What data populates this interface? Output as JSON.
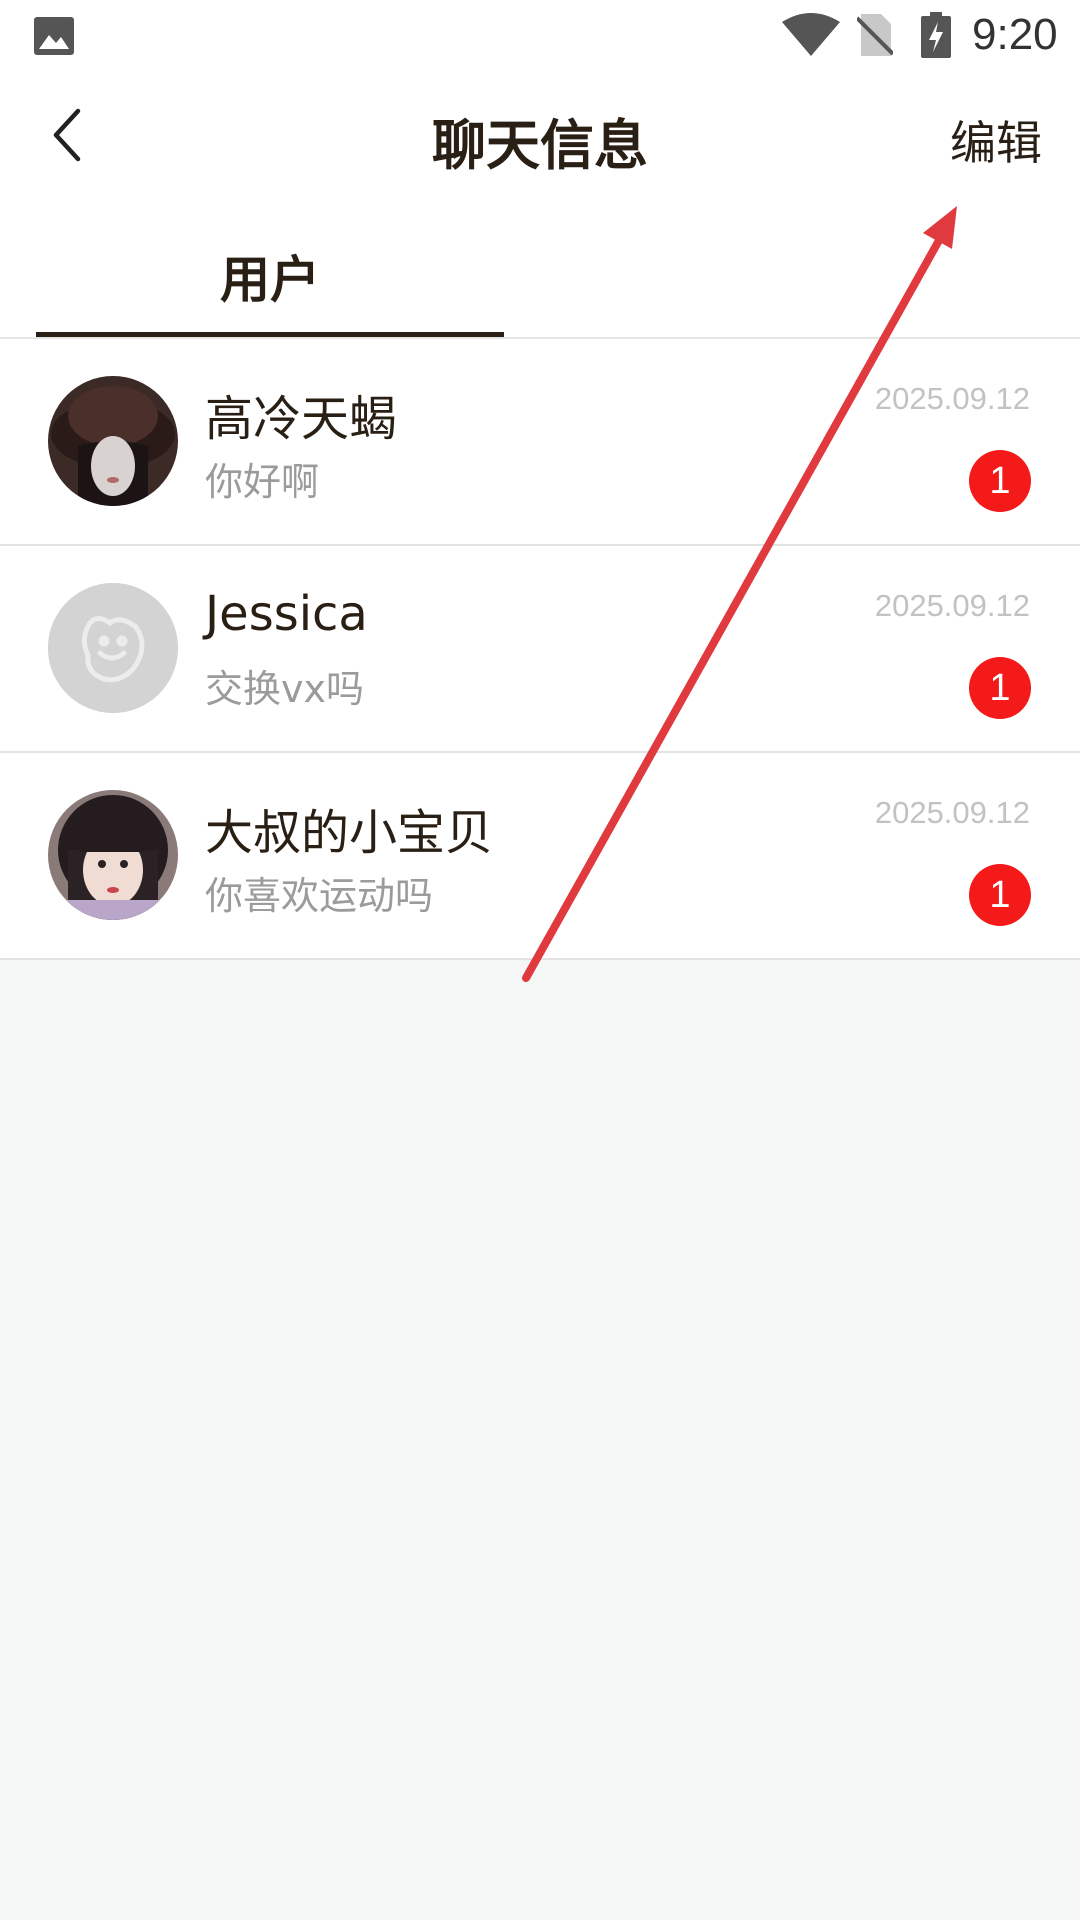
{
  "status_bar": {
    "time": "9:20",
    "icons": [
      "gallery-icon",
      "wifi-icon",
      "no-sim-icon",
      "battery-charging-icon"
    ]
  },
  "header": {
    "title": "聊天信息",
    "edit_label": "编辑",
    "back_icon": "chevron-left-icon"
  },
  "tabs": [
    {
      "label": "用户",
      "active": true
    }
  ],
  "conversations": [
    {
      "name": "高冷天蝎",
      "message": "你好啊",
      "date": "2025.09.12",
      "unread": "1",
      "avatar": "photo-woman-black-hat"
    },
    {
      "name": "Jessica",
      "message": "交换vx吗",
      "date": "2025.09.12",
      "unread": "1",
      "avatar": "default-avatar-placeholder"
    },
    {
      "name": "大叔的小宝贝",
      "message": "你喜欢运动吗",
      "date": "2025.09.12",
      "unread": "1",
      "avatar": "photo-girl-bangs"
    }
  ],
  "colors": {
    "text_primary": "#2a1f14",
    "text_secondary": "#9b9b9b",
    "date": "#c2c2c2",
    "badge": "#f41a1a",
    "page_background": "#f5f6f6",
    "annotation_arrow": "#e0393e"
  },
  "annotation": {
    "type": "arrow",
    "points_to": "edit-button"
  }
}
